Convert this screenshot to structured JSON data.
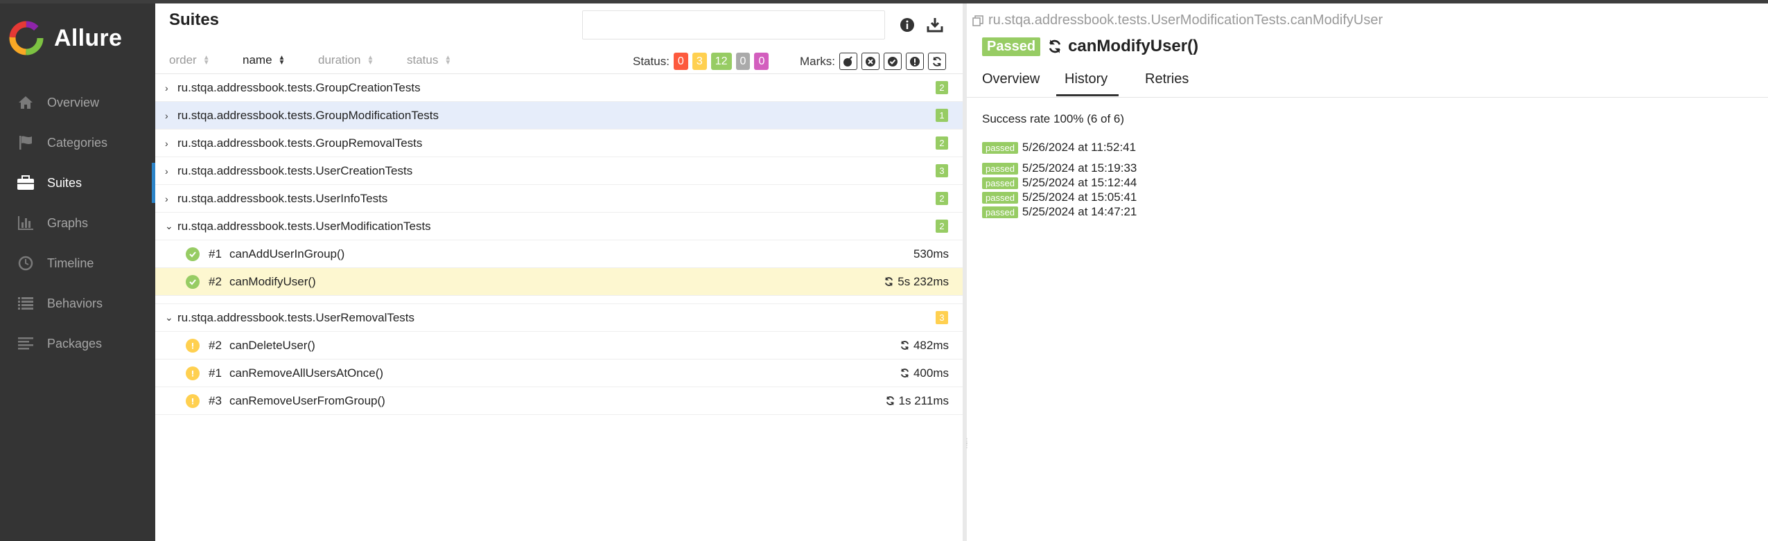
{
  "brand": {
    "name": "Allure"
  },
  "nav": [
    {
      "label": "Overview",
      "icon": "home-icon"
    },
    {
      "label": "Categories",
      "icon": "flag-icon"
    },
    {
      "label": "Suites",
      "icon": "briefcase-icon",
      "active": true
    },
    {
      "label": "Graphs",
      "icon": "bar-chart-icon"
    },
    {
      "label": "Timeline",
      "icon": "clock-icon"
    },
    {
      "label": "Behaviors",
      "icon": "list-icon"
    },
    {
      "label": "Packages",
      "icon": "align-left-icon"
    }
  ],
  "left": {
    "title": "Suites",
    "search_value": "",
    "sort": {
      "order": "order",
      "name": "name",
      "duration": "duration",
      "status": "status"
    },
    "status_label": "Status:",
    "status_counts": [
      {
        "value": "0",
        "color": "#fd5a3e"
      },
      {
        "value": "3",
        "color": "#ffd050"
      },
      {
        "value": "12",
        "color": "#97cc64"
      },
      {
        "value": "0",
        "color": "#aaaaaa"
      },
      {
        "value": "0",
        "color": "#d35ebe"
      }
    ],
    "marks_label": "Marks:",
    "groups": [
      {
        "name": "ru.stqa.addressbook.tests.GroupCreationTests",
        "count": "2",
        "color": "#97cc64"
      },
      {
        "name": "ru.stqa.addressbook.tests.GroupModificationTests",
        "count": "1",
        "color": "#97cc64"
      },
      {
        "name": "ru.stqa.addressbook.tests.GroupRemovalTests",
        "count": "2",
        "color": "#97cc64"
      },
      {
        "name": "ru.stqa.addressbook.tests.UserCreationTests",
        "count": "3",
        "color": "#97cc64"
      },
      {
        "name": "ru.stqa.addressbook.tests.UserInfoTests",
        "count": "2",
        "color": "#97cc64"
      },
      {
        "name": "ru.stqa.addressbook.tests.UserModificationTests",
        "count": "2",
        "color": "#97cc64"
      },
      {
        "name": "ru.stqa.addressbook.tests.UserRemovalTests",
        "count": "3",
        "color": "#ffd050"
      }
    ],
    "mod_tests": [
      {
        "num": "#1",
        "name": "canAddUserInGroup()",
        "duration": "530ms"
      },
      {
        "num": "#2",
        "name": "canModifyUser()",
        "duration": "5s 232ms"
      }
    ],
    "removal_tests": [
      {
        "num": "#2",
        "name": "canDeleteUser()",
        "duration": "482ms"
      },
      {
        "num": "#1",
        "name": "canRemoveAllUsersAtOnce()",
        "duration": "400ms"
      },
      {
        "num": "#3",
        "name": "canRemoveUserFromGroup()",
        "duration": "1s 211ms"
      }
    ]
  },
  "right": {
    "breadcrumb": "ru.stqa.addressbook.tests.UserModificationTests.canModifyUser",
    "status": "Passed",
    "test_name": "canModifyUser()",
    "tabs": [
      "Overview",
      "History",
      "Retries"
    ],
    "success_rate": "Success rate 100% (6 of 6)",
    "history": [
      {
        "status": "passed",
        "time": "5/26/2024 at 11:52:41"
      },
      {
        "status": "passed",
        "time": "5/25/2024 at 15:19:33"
      },
      {
        "status": "passed",
        "time": "5/25/2024 at 15:12:44"
      },
      {
        "status": "passed",
        "time": "5/25/2024 at 15:05:41"
      },
      {
        "status": "passed",
        "time": "5/25/2024 at 14:47:21"
      }
    ]
  }
}
